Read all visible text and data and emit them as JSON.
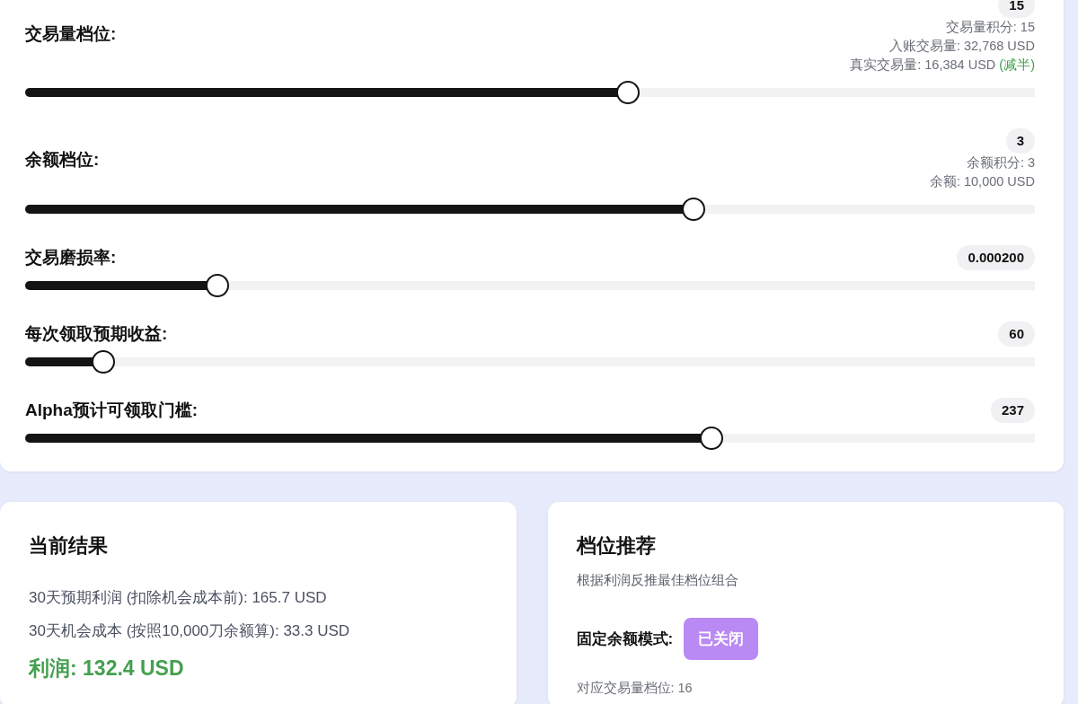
{
  "sliders": [
    {
      "label": "交易量档位:",
      "value": "15",
      "level": 0.597,
      "info": [
        {
          "text": "交易量积分: 15"
        },
        {
          "text": "入账交易量: 32,768 USD"
        },
        {
          "text": "真实交易量: 16,384 USD",
          "note": "(减半)"
        }
      ]
    },
    {
      "label": "余额档位:",
      "value": "3",
      "level": 0.662,
      "info": [
        {
          "text": "余额积分: 3"
        },
        {
          "text": "余额: 10,000 USD"
        }
      ]
    },
    {
      "label": "交易磨损率:",
      "value": "0.000200",
      "level": 0.19
    },
    {
      "label": "每次领取预期收益:",
      "value": "60",
      "level": 0.077
    },
    {
      "label": "Alpha预计可领取门槛:",
      "value": "237",
      "level": 0.68
    }
  ],
  "results": {
    "title": "当前结果",
    "lines": [
      "30天预期利润 (扣除机会成本前): 165.7 USD",
      "30天机会成本 (按照10,000刀余额算): 33.3 USD"
    ],
    "profit": "利润: 132.4 USD"
  },
  "recommend": {
    "title": "档位推荐",
    "subtitle": "根据利润反推最佳档位组合",
    "mode_label": "固定余额模式:",
    "mode_toggle": {
      "label": "已关闭",
      "on": false
    },
    "lines": [
      "对应交易量档位: 16"
    ]
  }
}
